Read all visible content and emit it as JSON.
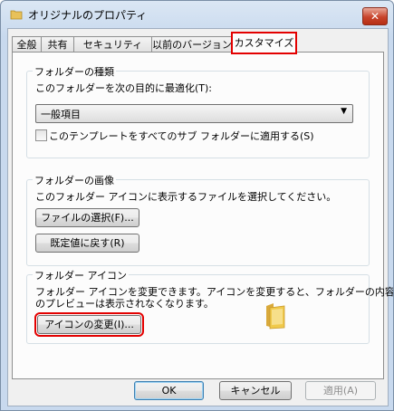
{
  "window": {
    "title": "オリジナルのプロパティ",
    "close_label": "✕"
  },
  "tabs": [
    {
      "label": "全般"
    },
    {
      "label": "共有"
    },
    {
      "label": "セキュリティ"
    },
    {
      "label": "以前のバージョン"
    },
    {
      "label": "カスタマイズ",
      "active": true
    }
  ],
  "folder_type": {
    "title": "フォルダーの種類",
    "optimize_label": "このフォルダーを次の目的に最適化(T):",
    "selected_option": "一般項目",
    "apply_subfolders_label": "このテンプレートをすべてのサブ フォルダーに適用する(S)",
    "apply_subfolders_checked": false
  },
  "folder_picture": {
    "title": "フォルダーの画像",
    "description": "このフォルダー アイコンに表示するファイルを選択してください。",
    "choose_file_button": "ファイルの選択(F)...",
    "restore_default_button": "既定値に戻す(R)"
  },
  "folder_icon": {
    "title": "フォルダー アイコン",
    "description_line1": "フォルダー アイコンを変更できます。アイコンを変更すると、フォルダーの内容",
    "description_line2": "のプレビューは表示されなくなります。",
    "change_icon_button": "アイコンの変更(I)..."
  },
  "footer": {
    "ok": "OK",
    "cancel": "キャンセル",
    "apply": "適用(A)"
  },
  "colors": {
    "highlight_box": "#e30000",
    "folder_yellow": "#f0c94a"
  }
}
